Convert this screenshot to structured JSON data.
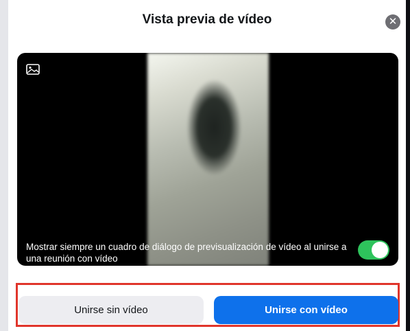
{
  "dialog": {
    "title": "Vista previa de vídeo",
    "close_icon": "close-icon"
  },
  "preview": {
    "media_icon": "image-icon",
    "always_show_text": "Mostrar siempre un cuadro de diálogo de previsualización de vídeo al unirse a una reunión con vídeo",
    "toggle_on": true
  },
  "actions": {
    "join_without_video": "Unirse sin vídeo",
    "join_with_video": "Unirse con vídeo"
  },
  "colors": {
    "primary": "#0e71eb",
    "toggle": "#2ec35c",
    "highlight": "#e0352b"
  }
}
